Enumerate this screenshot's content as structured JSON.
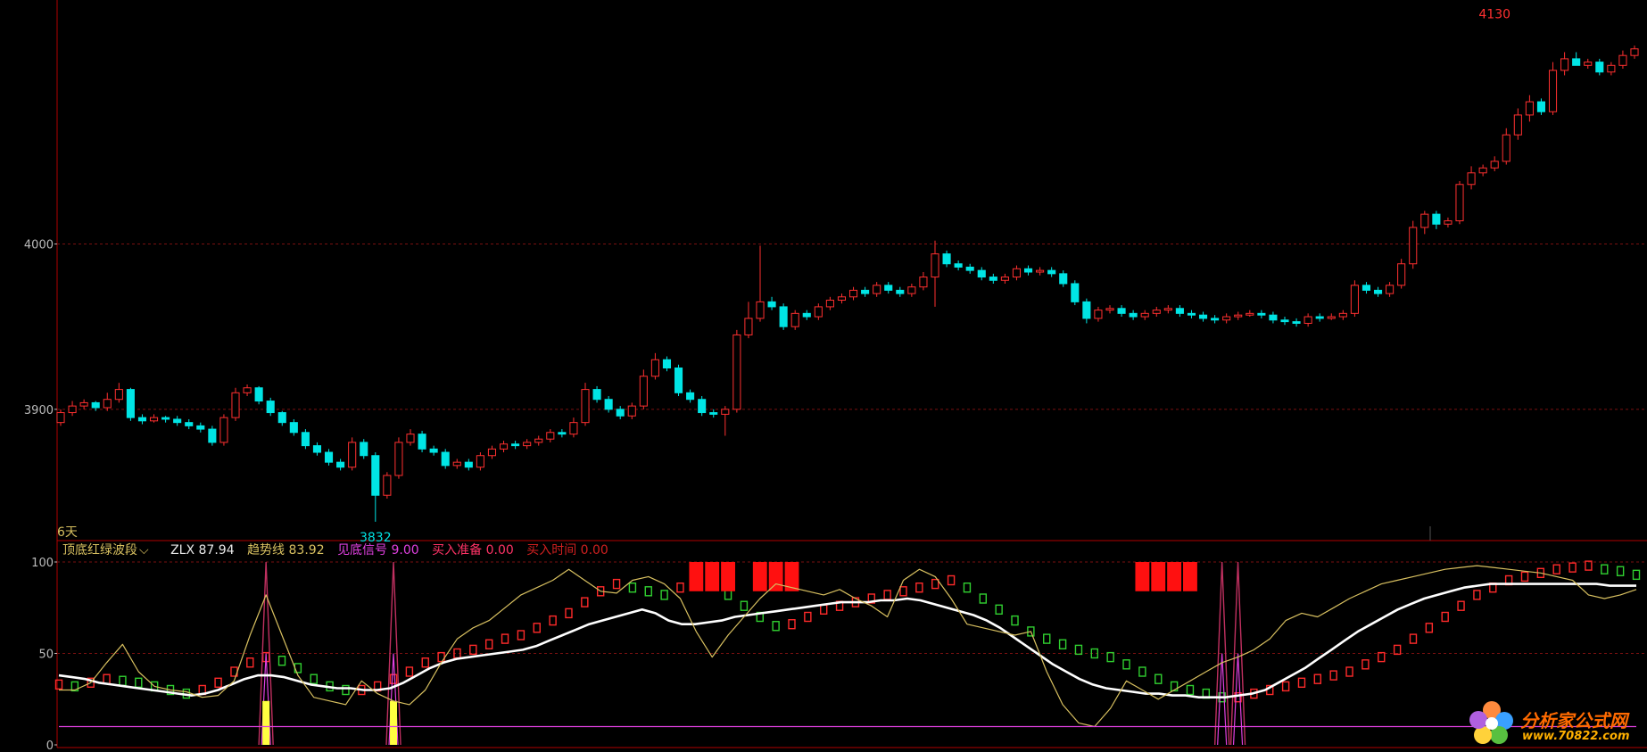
{
  "period_label": "6天",
  "indicator": {
    "name": "顶底红绿波段",
    "dropdown_glyph": "⌵",
    "items": [
      {
        "label": "ZLX",
        "value": "87.94",
        "color": "#e8e8e8"
      },
      {
        "label": "趋势线",
        "value": "83.92",
        "color": "#d8c060"
      },
      {
        "label": "见底信号",
        "value": "9.00",
        "color": "#e040e0"
      },
      {
        "label": "买入准备",
        "value": "0.00",
        "color": "#ff3366"
      },
      {
        "label": "买入时间",
        "value": "0.00",
        "color": "#d02020"
      }
    ]
  },
  "watermark": {
    "name": "分析家公式网",
    "url": "www.70822.com"
  },
  "colors": {
    "up": "#ff3030",
    "down": "#00e5e5",
    "grid": "#7a1010",
    "axis": "#b00000"
  },
  "chart_data": [
    {
      "type": "candlestick",
      "y_ticks": [
        3900,
        4000
      ],
      "y_range": [
        3826,
        4140
      ],
      "annotations": [
        {
          "text": "4130",
          "value": 4130,
          "index": 123,
          "color": "#ff3030"
        },
        {
          "text": "3832",
          "value": 3832,
          "index": 27,
          "color": "#00e5e5"
        }
      ],
      "closes": [
        3898,
        3902,
        3904,
        3901,
        3906,
        3912,
        3895,
        3893,
        3895,
        3894,
        3892,
        3890,
        3888,
        3880,
        3895,
        3910,
        3913,
        3905,
        3898,
        3892,
        3886,
        3878,
        3874,
        3868,
        3865,
        3880,
        3872,
        3848,
        3860,
        3880,
        3885,
        3876,
        3874,
        3866,
        3868,
        3865,
        3872,
        3876,
        3879,
        3878,
        3880,
        3882,
        3886,
        3885,
        3892,
        3912,
        3906,
        3900,
        3896,
        3902,
        3920,
        3930,
        3925,
        3910,
        3906,
        3898,
        3897,
        3900,
        3945,
        3955,
        3965,
        3962,
        3950,
        3958,
        3956,
        3962,
        3966,
        3968,
        3972,
        3970,
        3975,
        3972,
        3970,
        3974,
        3980,
        3994,
        3988,
        3986,
        3984,
        3980,
        3978,
        3980,
        3985,
        3983,
        3984,
        3982,
        3976,
        3965,
        3955,
        3960,
        3961,
        3958,
        3956,
        3958,
        3960,
        3961,
        3958,
        3957,
        3955,
        3954,
        3956,
        3957,
        3958,
        3957,
        3954,
        3953,
        3952,
        3956,
        3955,
        3956,
        3958,
        3975,
        3972,
        3970,
        3975,
        3988,
        4010,
        4018,
        4012,
        4014,
        4036,
        4043,
        4046,
        4050,
        4066,
        4078,
        4086,
        4080,
        4105,
        4112,
        4108,
        4110,
        4104,
        4108,
        4114,
        4118
      ],
      "opens": [
        3892,
        3898,
        3902,
        3904,
        3901,
        3906,
        3912,
        3895,
        3893,
        3895,
        3894,
        3892,
        3890,
        3888,
        3880,
        3895,
        3910,
        3913,
        3905,
        3898,
        3892,
        3886,
        3878,
        3874,
        3868,
        3865,
        3880,
        3872,
        3848,
        3860,
        3880,
        3885,
        3876,
        3874,
        3866,
        3868,
        3865,
        3872,
        3876,
        3879,
        3878,
        3880,
        3882,
        3886,
        3885,
        3892,
        3912,
        3906,
        3900,
        3896,
        3902,
        3920,
        3930,
        3925,
        3910,
        3906,
        3898,
        3897,
        3900,
        3945,
        3955,
        3965,
        3962,
        3950,
        3958,
        3956,
        3962,
        3966,
        3968,
        3972,
        3970,
        3975,
        3972,
        3970,
        3974,
        3980,
        3994,
        3988,
        3986,
        3984,
        3980,
        3978,
        3980,
        3985,
        3983,
        3984,
        3982,
        3976,
        3965,
        3955,
        3960,
        3961,
        3958,
        3956,
        3958,
        3960,
        3961,
        3958,
        3957,
        3955,
        3954,
        3956,
        3957,
        3958,
        3957,
        3954,
        3953,
        3952,
        3956,
        3955,
        3956,
        3958,
        3975,
        3972,
        3970,
        3975,
        3988,
        4010,
        4018,
        4012,
        4014,
        4036,
        4043,
        4046,
        4050,
        4066,
        4078,
        4086,
        4080,
        4105,
        4112,
        4108,
        4110,
        4104,
        4108,
        4114
      ],
      "highs": [
        3900,
        3905,
        3906,
        3905,
        3910,
        3916,
        3913,
        3897,
        3897,
        3896,
        3896,
        3894,
        3892,
        3890,
        3897,
        3913,
        3915,
        3914,
        3907,
        3899,
        3894,
        3888,
        3880,
        3876,
        3870,
        3883,
        3882,
        3874,
        3862,
        3883,
        3888,
        3887,
        3878,
        3876,
        3870,
        3870,
        3874,
        3878,
        3881,
        3881,
        3882,
        3884,
        3888,
        3888,
        3895,
        3916,
        3914,
        3908,
        3902,
        3904,
        3924,
        3934,
        3932,
        3927,
        3912,
        3908,
        3900,
        3902,
        3948,
        3965,
        3999,
        3968,
        3964,
        3960,
        3960,
        3964,
        3968,
        3970,
        3974,
        3974,
        3977,
        3977,
        3974,
        3976,
        3983,
        4002,
        3996,
        3990,
        3988,
        3986,
        3982,
        3982,
        3987,
        3987,
        3986,
        3986,
        3984,
        3978,
        3967,
        3962,
        3963,
        3963,
        3960,
        3960,
        3962,
        3963,
        3963,
        3960,
        3959,
        3957,
        3958,
        3959,
        3960,
        3960,
        3959,
        3956,
        3955,
        3958,
        3958,
        3958,
        3960,
        3978,
        3977,
        3974,
        3977,
        3991,
        4014,
        4020,
        4020,
        4016,
        4038,
        4047,
        4048,
        4053,
        4070,
        4082,
        4090,
        4088,
        4110,
        4116,
        4116,
        4112,
        4112,
        4110,
        4117,
        4120
      ],
      "lows": [
        3890,
        3896,
        3900,
        3899,
        3899,
        3904,
        3893,
        3891,
        3892,
        3892,
        3890,
        3888,
        3886,
        3878,
        3878,
        3893,
        3908,
        3903,
        3896,
        3890,
        3884,
        3876,
        3872,
        3866,
        3863,
        3863,
        3870,
        3832,
        3846,
        3858,
        3878,
        3874,
        3872,
        3864,
        3864,
        3863,
        3863,
        3870,
        3874,
        3876,
        3876,
        3878,
        3880,
        3883,
        3883,
        3890,
        3904,
        3898,
        3894,
        3894,
        3900,
        3918,
        3923,
        3908,
        3904,
        3896,
        3895,
        3884,
        3898,
        3943,
        3953,
        3960,
        3948,
        3948,
        3954,
        3954,
        3960,
        3964,
        3966,
        3968,
        3968,
        3970,
        3968,
        3968,
        3972,
        3962,
        3986,
        3984,
        3982,
        3978,
        3976,
        3976,
        3978,
        3981,
        3981,
        3980,
        3974,
        3963,
        3952,
        3953,
        3958,
        3956,
        3954,
        3954,
        3956,
        3958,
        3956,
        3955,
        3953,
        3952,
        3952,
        3954,
        3956,
        3955,
        3952,
        3951,
        3950,
        3950,
        3953,
        3954,
        3954,
        3956,
        3970,
        3968,
        3968,
        3973,
        3985,
        4006,
        4009,
        4010,
        4012,
        4033,
        4041,
        4044,
        4048,
        4063,
        4074,
        4078,
        4078,
        4102,
        4108,
        4106,
        4102,
        4102,
        4106,
        4112
      ]
    },
    {
      "type": "line",
      "y_ticks": [
        0,
        50,
        100
      ],
      "y_range": [
        0,
        100
      ],
      "x_count": 150,
      "series": [
        {
          "name": "ZLX",
          "color": "#ffffff",
          "values": [
            38,
            37,
            36,
            34,
            33,
            32,
            31,
            30,
            29,
            28,
            27,
            28,
            30,
            33,
            36,
            38,
            38,
            37,
            35,
            33,
            32,
            31,
            31,
            30,
            30,
            31,
            34,
            38,
            42,
            45,
            47,
            48,
            49,
            50,
            51,
            52,
            54,
            57,
            60,
            63,
            66,
            68,
            70,
            72,
            74,
            72,
            68,
            66,
            66,
            67,
            68,
            70,
            71,
            72,
            73,
            74,
            75,
            76,
            77,
            78,
            78,
            78,
            79,
            79,
            80,
            79,
            77,
            75,
            73,
            71,
            68,
            64,
            59,
            54,
            49,
            44,
            40,
            36,
            33,
            31,
            30,
            29,
            28,
            28,
            27,
            27,
            26,
            26,
            26,
            27,
            28,
            30,
            34,
            38,
            42,
            47,
            52,
            57,
            62,
            66,
            70,
            74,
            77,
            80,
            82,
            84,
            86,
            87,
            88,
            88,
            88,
            88,
            88,
            88,
            88,
            88,
            88,
            87,
            87,
            87
          ]
        },
        {
          "name": "趋势线",
          "color": "#d8c060",
          "values": [
            30,
            30,
            34,
            45,
            55,
            40,
            32,
            30,
            29,
            26,
            27,
            35,
            60,
            82,
            60,
            38,
            26,
            24,
            22,
            35,
            28,
            24,
            22,
            30,
            45,
            58,
            64,
            68,
            75,
            82,
            86,
            90,
            96,
            90,
            84,
            83,
            90,
            92,
            88,
            80,
            62,
            48,
            60,
            70,
            80,
            88,
            86,
            84,
            82,
            85,
            80,
            76,
            70,
            90,
            96,
            92,
            80,
            66,
            64,
            62,
            60,
            62,
            40,
            22,
            12,
            10,
            20,
            35,
            30,
            25,
            30,
            35,
            40,
            45,
            48,
            52,
            58,
            68,
            72,
            70,
            75,
            80,
            84,
            88,
            90,
            92,
            94,
            96,
            97,
            98,
            97,
            96,
            95,
            94,
            92,
            90,
            82,
            80,
            82,
            85
          ]
        },
        {
          "name": "见底信号",
          "color": "#e040e0",
          "values": [
            10,
            10,
            10,
            10,
            10,
            10,
            10,
            10,
            10,
            10,
            10,
            10,
            10,
            10,
            10,
            10,
            10,
            10,
            10,
            10,
            10,
            10,
            10,
            10,
            10,
            10,
            10,
            10,
            10,
            10,
            10,
            10,
            10,
            10,
            10,
            10,
            10,
            10,
            10,
            10,
            10,
            10,
            10,
            10,
            10,
            10,
            10,
            10,
            10,
            10,
            10,
            10,
            10,
            10,
            10,
            10,
            10,
            10,
            10,
            10,
            10,
            10,
            10,
            10,
            10,
            10,
            10,
            10,
            10,
            10,
            10,
            10,
            10,
            10,
            10,
            10,
            10,
            10,
            10,
            10,
            10,
            10,
            10,
            10,
            10,
            10,
            10,
            10,
            10,
            10,
            10,
            10,
            10,
            10,
            10,
            10,
            10,
            10,
            10,
            10
          ]
        }
      ],
      "band_values": [
        33,
        32,
        34,
        36,
        35,
        34,
        32,
        30,
        28,
        30,
        34,
        40,
        45,
        48,
        46,
        42,
        36,
        32,
        30,
        30,
        32,
        36,
        40,
        45,
        48,
        50,
        52,
        55,
        58,
        60,
        64,
        68,
        72,
        78,
        84,
        88,
        86,
        84,
        82,
        86,
        90,
        88,
        82,
        76,
        70,
        65,
        66,
        70,
        74,
        76,
        78,
        80,
        82,
        84,
        86,
        88,
        90,
        86,
        80,
        74,
        68,
        62,
        58,
        55,
        52,
        50,
        48,
        44,
        40,
        36,
        32,
        30,
        28,
        26,
        26,
        28,
        30,
        32,
        34,
        36,
        38,
        40,
        44,
        48,
        52,
        58,
        64,
        70,
        76,
        82,
        86,
        90,
        92,
        94,
        96,
        97,
        98,
        96,
        95,
        93
      ],
      "bar_signals": [
        {
          "kind": "top",
          "from": 40,
          "to": 42
        },
        {
          "kind": "top",
          "from": 44,
          "to": 46
        },
        {
          "kind": "top",
          "from": 68,
          "to": 71
        },
        {
          "kind": "top",
          "from": 123,
          "to": 148
        }
      ],
      "spikes": [
        {
          "index": 13,
          "value": 100,
          "color": "#c03060"
        },
        {
          "index": 21,
          "value": 100,
          "color": "#c03060"
        },
        {
          "index": 73,
          "value": 100,
          "color": "#c03060"
        },
        {
          "index": 74,
          "value": 100,
          "color": "#c03060"
        }
      ],
      "bottom_bars": [
        {
          "index": 13,
          "value": 24,
          "color": "#ffff40"
        },
        {
          "index": 21,
          "value": 24,
          "color": "#ffff40"
        }
      ]
    }
  ]
}
